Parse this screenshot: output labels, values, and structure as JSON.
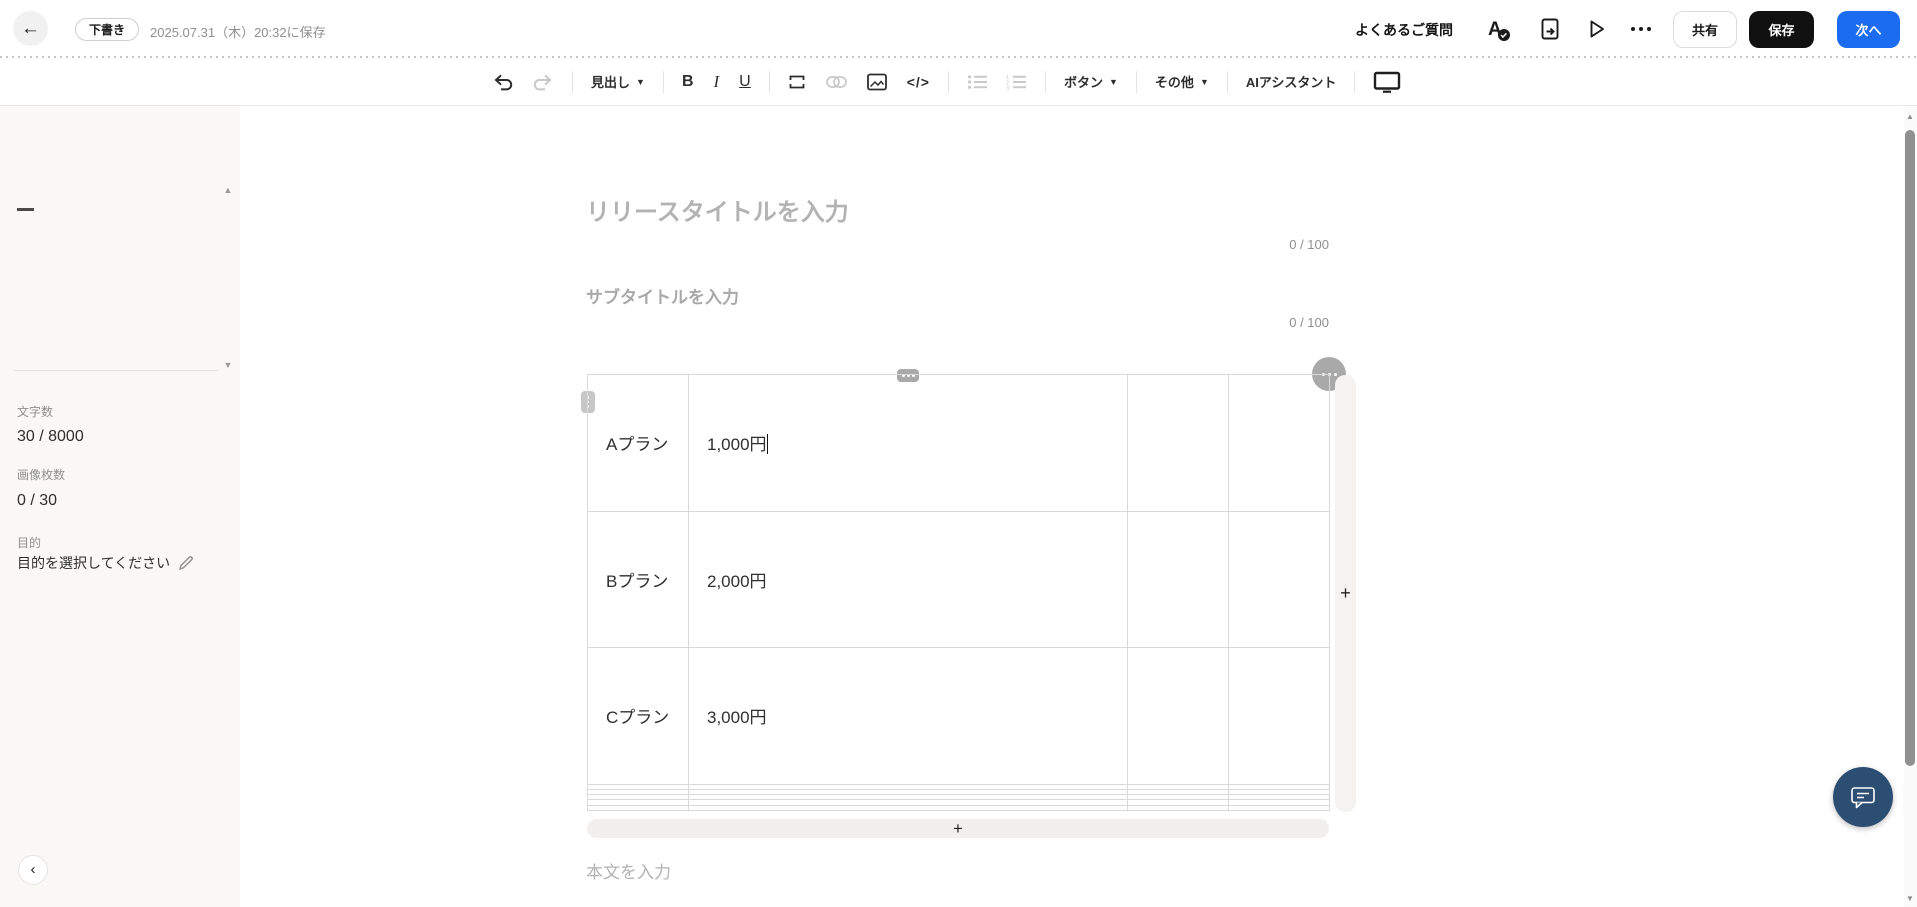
{
  "header": {
    "draft_badge": "下書き",
    "saved_at": "2025.07.31（木）20:32に保存",
    "faq_label": "よくあるご質問",
    "share_label": "共有",
    "save_label": "保存",
    "next_label": "次へ"
  },
  "toolbar": {
    "heading_label": "見出し",
    "bold_label": "B",
    "italic_label": "I",
    "underline_label": "U",
    "code_label": "</>",
    "button_label": "ボタン",
    "other_label": "その他",
    "ai_label": "AIアシスタント"
  },
  "sidebar": {
    "char_count": {
      "label": "文字数",
      "value": "30 / 8000"
    },
    "image_count": {
      "label": "画像枚数",
      "value": "0 / 30"
    },
    "purpose": {
      "label": "目的",
      "value": "目的を選択してください"
    }
  },
  "editor": {
    "title_placeholder": "リリースタイトルを入力",
    "title_counter": "0 / 100",
    "subtitle_placeholder": "サブタイトルを入力",
    "subtitle_counter": "0 / 100",
    "body_placeholder": "本文を入力",
    "add_plus": "+",
    "table": {
      "rows": [
        [
          "Aプラン",
          "1,000円",
          "",
          ""
        ],
        [
          "Bプラン",
          "2,000円",
          "",
          ""
        ],
        [
          "Cプラン",
          "3,000円",
          "",
          ""
        ],
        [
          "",
          "",
          "",
          ""
        ],
        [
          "",
          "",
          "",
          ""
        ],
        [
          "",
          "",
          "",
          ""
        ],
        [
          "",
          "",
          "",
          ""
        ],
        [
          "",
          "",
          "",
          ""
        ]
      ]
    }
  },
  "icons": {
    "back": "←",
    "caret_down": "▼",
    "triangle_up": "▲",
    "triangle_down": "▼",
    "chevron_left": "‹"
  },
  "colors": {
    "accent_blue": "#1c6cf2",
    "save_black": "#111111",
    "chat_navy": "#2d4e73",
    "sidebar_bg": "#f9f8f7",
    "table_border": "#d9d9d9",
    "placeholder_gray": "#b3b3b3"
  }
}
